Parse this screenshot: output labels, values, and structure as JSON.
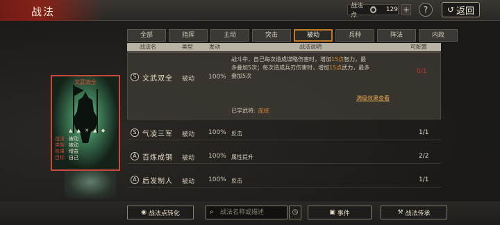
{
  "header": {
    "title": "战法",
    "points_label": "战法点",
    "points_value": "129",
    "plus": "+",
    "help": "?",
    "back": "返回",
    "back_arrow": "↺"
  },
  "tabs": [
    {
      "label": "全部"
    },
    {
      "label": "指挥"
    },
    {
      "label": "主动"
    },
    {
      "label": "突击"
    },
    {
      "label": "被动",
      "active": true
    },
    {
      "label": "兵种"
    },
    {
      "label": "阵法"
    },
    {
      "label": "内政"
    }
  ],
  "table_header": {
    "name": "战法名",
    "type": "类型",
    "rate": "发动",
    "desc": "战法说明",
    "configurable": "可配置"
  },
  "expanded": {
    "grade": "S",
    "name": "文武双全",
    "type": "被动",
    "rate": "100%",
    "desc_line1_a": "战斗中，自己每次造成谋略伤害时，增加",
    "desc_line1_hl": "15点",
    "desc_line1_b": "智力，最",
    "desc_line2": "多叠加5次；每次造成兵刃伤害时，增加",
    "desc_line2_hl": "15点",
    "desc_line2_b": "武力，最多",
    "desc_line3": "叠加5次",
    "full_effect": "满级效果查看",
    "learned_label": "已学武将:",
    "learned_general": "庞统",
    "count": "0/1"
  },
  "rows": [
    {
      "grade": "S",
      "name": "气凌三军",
      "type": "被动",
      "rate": "100%",
      "desc": "反击",
      "count": "1/1"
    },
    {
      "grade": "A",
      "name": "百炼成钢",
      "type": "被动",
      "rate": "100%",
      "desc": "属性提升",
      "count": "2/2"
    },
    {
      "grade": "A",
      "name": "后发制人",
      "type": "被动",
      "rate": "100%",
      "desc": "反击",
      "count": "1/1"
    }
  ],
  "card": {
    "title": "文武双全",
    "stats": [
      {
        "k": "战法",
        "v": "被动"
      },
      {
        "k": "类型",
        "v": "被动"
      },
      {
        "k": "效果",
        "v": "增益"
      },
      {
        "k": "目标",
        "v": "自己"
      }
    ],
    "icons": "▲ ▲ ✕ ▲ ◆"
  },
  "bottom": {
    "convert": "战法点转化",
    "search_placeholder": "战法名称或描述",
    "events": "事件",
    "inherit": "战法传承"
  }
}
